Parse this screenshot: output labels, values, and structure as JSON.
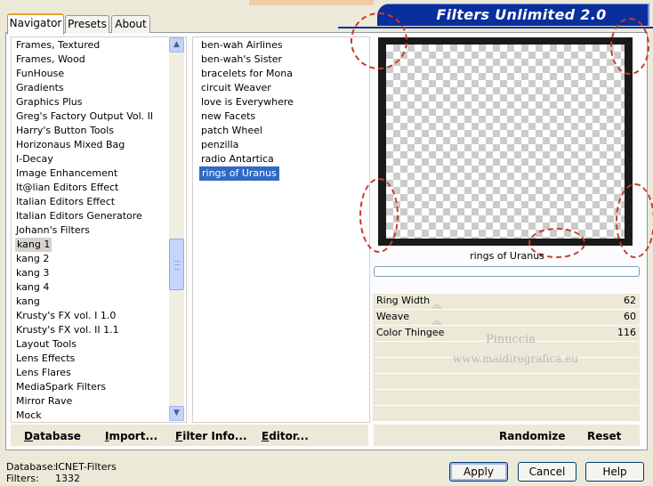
{
  "window": {
    "title": "Filters Unlimited 2.0"
  },
  "tabs": [
    {
      "label": "Navigator",
      "active": true
    },
    {
      "label": "Presets",
      "active": false
    },
    {
      "label": "About",
      "active": false
    }
  ],
  "categories": [
    "Frames, Textured",
    "Frames, Wood",
    "FunHouse",
    "Gradients",
    "Graphics Plus",
    "Greg's Factory Output Vol. II",
    "Harry's Button Tools",
    "Horizonaus Mixed Bag",
    "I-Decay",
    "Image Enhancement",
    "It@lian Editors Effect",
    "Italian Editors Effect",
    "Italian Editors Generatore",
    "Johann's Filters",
    "kang 1",
    "kang 2",
    "kang 3",
    "kang 4",
    "kang",
    "Krusty's FX vol. I 1.0",
    "Krusty's FX vol. II 1.1",
    "Layout Tools",
    "Lens Effects",
    "Lens Flares",
    "MediaSpark Filters",
    "Mirror Rave",
    "Mock"
  ],
  "selected_category": "kang 1",
  "filters": [
    "ben-wah Airlines",
    "ben-wah's Sister",
    "bracelets for Mona",
    "circuit Weaver",
    "love is Everywhere",
    "new Facets",
    "patch Wheel",
    "penzilla",
    "radio Antartica",
    "rings of Uranus"
  ],
  "selected_filter": "rings of Uranus",
  "preview": {
    "filter_name": "rings of Uranus",
    "progress": 0
  },
  "parameters": [
    {
      "label": "Ring Width",
      "value": "62"
    },
    {
      "label": "Weave",
      "value": "60"
    },
    {
      "label": "Color Thingee",
      "value": "116"
    }
  ],
  "watermark": {
    "line1": "Pinuccia",
    "line2": "www.maidiregrafica.eu"
  },
  "left_buttons": [
    {
      "label": "Database",
      "mnemonic": "D"
    },
    {
      "label": "Import...",
      "mnemonic": "I"
    },
    {
      "label": "Filter Info...",
      "mnemonic": "F"
    },
    {
      "label": "Editor...",
      "mnemonic": "E"
    }
  ],
  "right_buttons": [
    {
      "label": "Randomize"
    },
    {
      "label": "Reset"
    }
  ],
  "status": {
    "database_label": "Database:",
    "database_value": "ICNET-Filters",
    "filters_label": "Filters:",
    "filters_value": "1332"
  },
  "dialog_buttons": {
    "apply": "Apply",
    "cancel": "Cancel",
    "help": "Help"
  },
  "colors": {
    "banner": "#0a2f9c",
    "selection": "#316ac5"
  }
}
